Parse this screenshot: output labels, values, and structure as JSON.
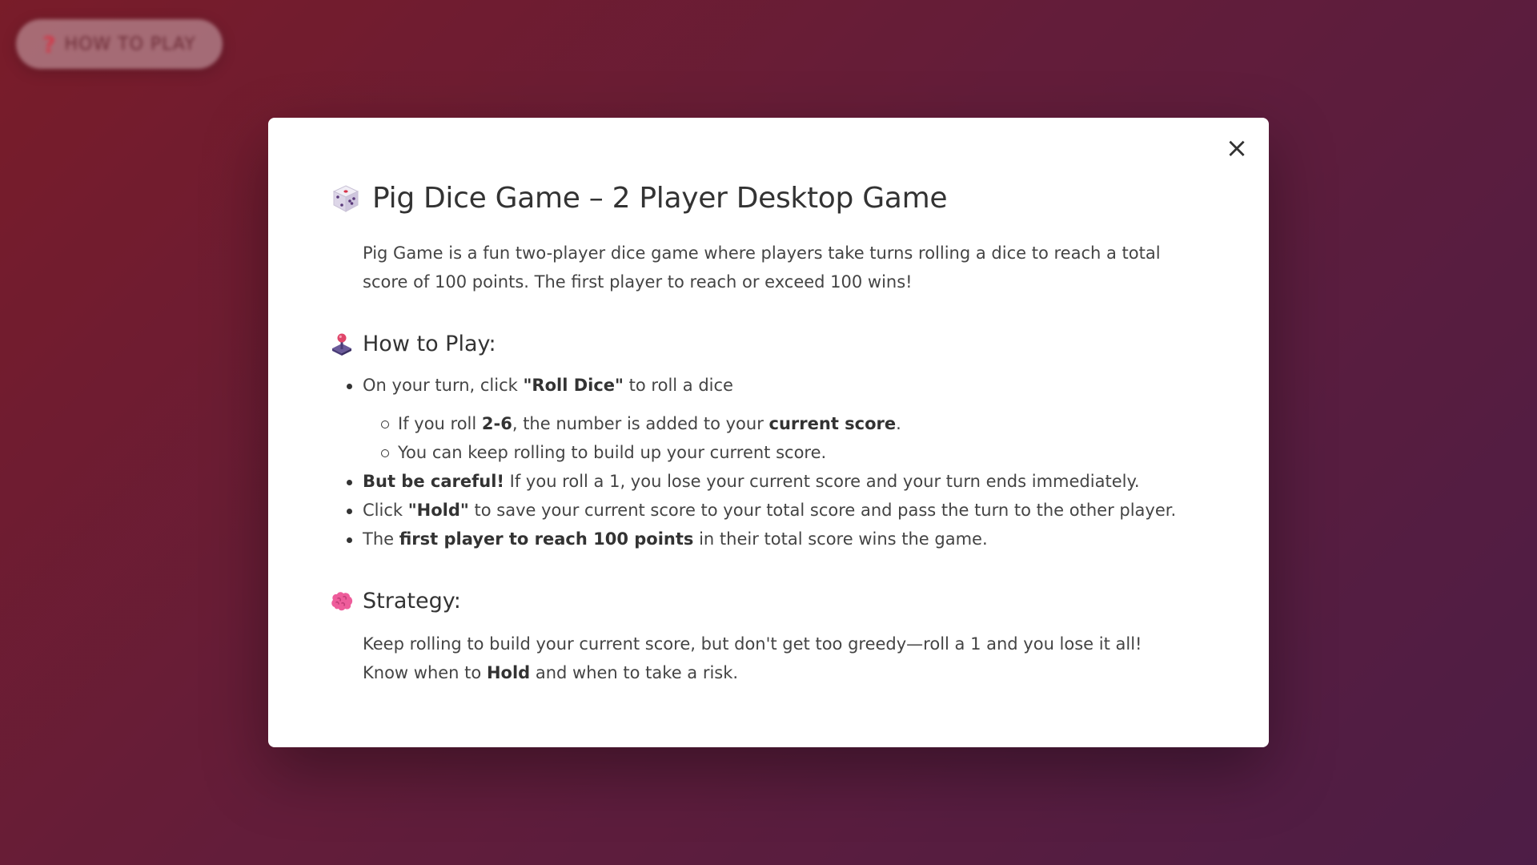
{
  "background_button": {
    "label": "HOW TO PLAY",
    "icon": "question-mark-icon"
  },
  "modal": {
    "close_icon": "×",
    "title": "Pig Dice Game – 2 Player Desktop Game",
    "title_icon": "die-icon",
    "intro": "Pig Game is a fun two-player dice game where players take turns rolling a dice to reach a total score of 100 points. The first player to reach or exceed 100 wins!",
    "how_to_play": {
      "heading": "How to Play:",
      "icon": "joystick-icon",
      "items": [
        {
          "pre": "On your turn, click ",
          "bold": "\"Roll Dice\"",
          "post": " to roll a dice"
        },
        {
          "pre": "",
          "bold": "But be careful!",
          "post": " If you roll a 1, you lose your current score and your turn ends immediately."
        },
        {
          "pre": "Click ",
          "bold": "\"Hold\"",
          "post": " to save your current score to your total score and pass the turn to the other player."
        },
        {
          "pre": "The ",
          "bold": "first player to reach 100 points",
          "post": " in their total score wins the game."
        }
      ],
      "sub_items": [
        {
          "pre": "If you roll ",
          "bold1": "2-6",
          "mid": ", the number is added to your ",
          "bold2": "current score",
          "post": "."
        },
        {
          "text": "You can keep rolling to build up your current score."
        }
      ]
    },
    "strategy": {
      "heading": "Strategy:",
      "icon": "brain-icon",
      "line1": "Keep rolling to build your current score, but don't get too greedy—roll a 1 and you lose it all!",
      "line2_pre": "Know when to ",
      "line2_bold": "Hold",
      "line2_post": " and when to take a risk."
    }
  },
  "colors": {
    "background_start": "#8a1f2a",
    "background_end": "#4f2150",
    "modal_bg": "#ffffff",
    "text": "#333333"
  }
}
